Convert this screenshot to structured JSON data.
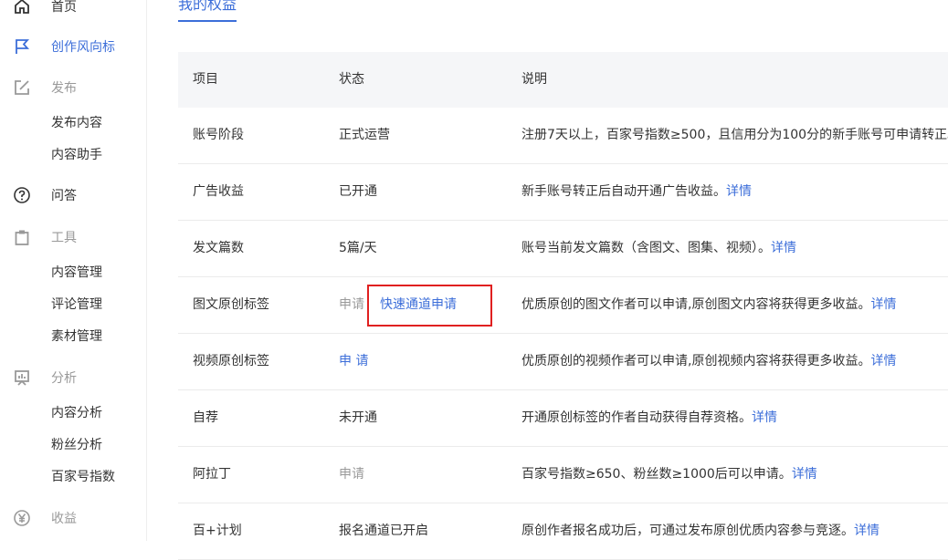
{
  "sidebar": {
    "items": [
      {
        "label": "首页",
        "icon": "home-icon"
      },
      {
        "label": "创作风向标",
        "icon": "flag-icon"
      },
      {
        "label": "发布",
        "icon": "edit-icon"
      },
      {
        "label": "问答",
        "icon": "question-icon"
      },
      {
        "label": "工具",
        "icon": "clipboard-icon"
      },
      {
        "label": "分析",
        "icon": "chart-icon"
      },
      {
        "label": "收益",
        "icon": "yen-icon"
      }
    ],
    "publish_sub": [
      "发布内容",
      "内容助手"
    ],
    "tools_sub": [
      "内容管理",
      "评论管理",
      "素材管理"
    ],
    "analysis_sub": [
      "内容分析",
      "粉丝分析",
      "百家号指数"
    ]
  },
  "main": {
    "tab": "我的权益",
    "headers": [
      "项目",
      "状态",
      "说明"
    ],
    "rows": [
      {
        "item": "账号阶段",
        "status": "正式运营",
        "desc": "注册7天以上，百家号指数≥500，且信用分为100分的新手账号可申请转正。",
        "link": ""
      },
      {
        "item": "广告收益",
        "status": "已开通",
        "desc": "新手账号转正后自动开通广告收益。",
        "link": "详情"
      },
      {
        "item": "发文篇数",
        "status": "5篇/天",
        "desc": "账号当前发文篇数（含图文、图集、视频）。",
        "link": "详情"
      },
      {
        "item": "图文原创标签",
        "status": "申请",
        "fast": "快速通道申请",
        "desc": "优质原创的图文作者可以申请,原创图文内容将获得更多收益。",
        "link": "详情"
      },
      {
        "item": "视频原创标签",
        "status": "申 请",
        "desc": "优质原创的视频作者可以申请,原创视频内容将获得更多收益。",
        "link": "详情"
      },
      {
        "item": "自荐",
        "status": "未开通",
        "desc": "开通原创标签的作者自动获得自荐资格。",
        "link": "详情"
      },
      {
        "item": "阿拉丁",
        "status": "申请",
        "desc": "百家号指数≥650、粉丝数≥1000后可以申请。",
        "link": "详情"
      },
      {
        "item": "百+计划",
        "status": "报名通道已开启",
        "desc": "原创作者报名成功后，可通过发布原创优质内容参与竞逐。",
        "link": "详情"
      }
    ]
  },
  "colors": {
    "accent": "#3c6ed9",
    "highlight": "#e02020",
    "header_bg": "#f5f6f8"
  }
}
